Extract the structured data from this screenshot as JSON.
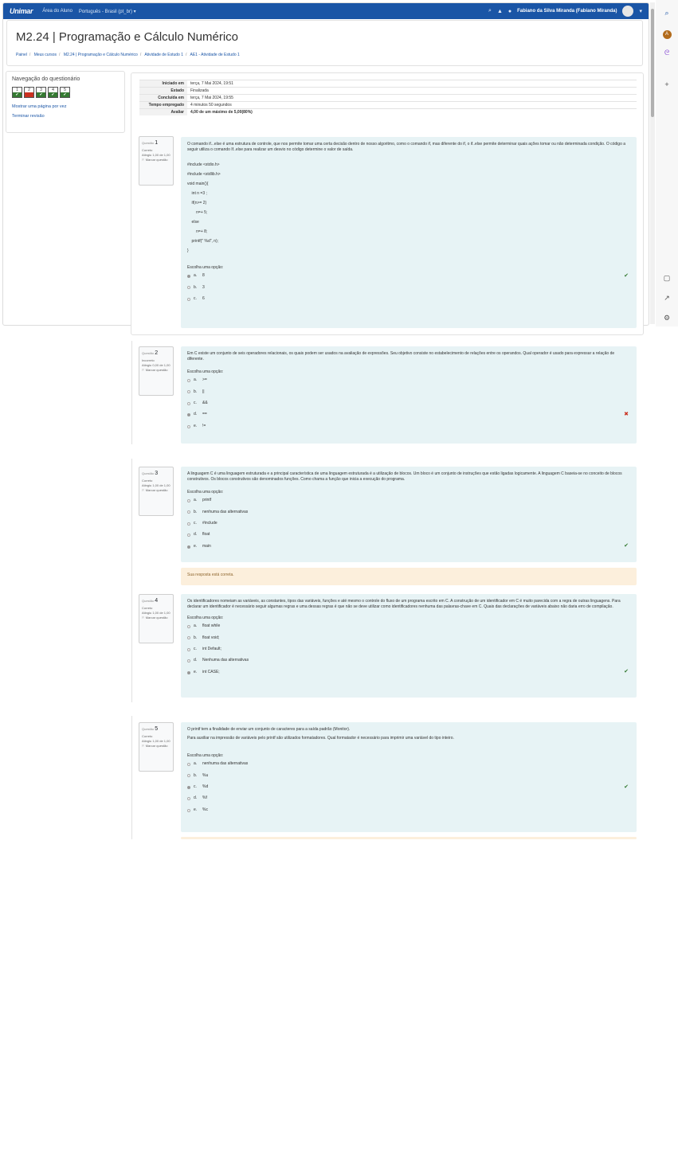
{
  "navbar": {
    "logo": "Unimar",
    "links": [
      "Área do Aluno",
      "Português - Brasil (pt_br) ▾"
    ],
    "user": "Fabiano da Silva Miranda (Fabiano Miranda)"
  },
  "header": {
    "title": "M2.24 | Programação e Cálculo Numérico",
    "breadcrumb": [
      "Painel",
      "Meus cursos",
      "M2.24 | Programação e Cálculo Numérico",
      "Atividade de Estudo 1",
      "AE1 - Atividade de Estudo 1"
    ]
  },
  "quiz_nav": {
    "title": "Navegação do questionário",
    "buttons": [
      {
        "num": "1",
        "state": "ok"
      },
      {
        "num": "2",
        "state": "bad"
      },
      {
        "num": "3",
        "state": "ok"
      },
      {
        "num": "4",
        "state": "ok"
      },
      {
        "num": "5",
        "state": "ok"
      }
    ],
    "show_one_page": "Mostrar uma página por vez",
    "end_review": "Terminar revisão"
  },
  "summary": [
    {
      "label": "Iniciado em",
      "value": "terça, 7 Mai 2024, 19:51"
    },
    {
      "label": "Estado",
      "value": "Finalizada"
    },
    {
      "label": "Concluída em",
      "value": "terça, 7 Mai 2024, 19:55"
    },
    {
      "label": "Tempo empregado",
      "value": "4 minutos 50 segundos"
    },
    {
      "label": "Avaliar",
      "value": "4,00 de um máximo de 5,00(80%)"
    }
  ],
  "questions": [
    {
      "label": "Questão",
      "number": "1",
      "status": "Correto",
      "grade": "Atingiu 1,00 de 1,00",
      "flag": "Marcar questão",
      "text": "O comando if...else é uma estrutura de controle, que nos permite tomar uma certa decisão dentro de nosso algoritmo, como o comando if, mas diferente do if, o if..else  permite determinar quais ações tomar ou não determinada condição.  O código a seguir utiliza o comando If..else para realizar um desvio no código determine o valor de saída.",
      "code": "#include <stdio.h>\n#include <stdlib.h>\nvoid main(){\n    int n =3 ;\n    if(n>= 2)\n        n=+ 5;\n    else\n        n=+ 8;\n    printf(\" %d\", n);\n}",
      "prompt": "Escolha uma opção:",
      "options": [
        {
          "letter": "a.",
          "text": "8",
          "selected": true,
          "mark": "correct"
        },
        {
          "letter": "b.",
          "text": "3",
          "selected": false,
          "mark": ""
        },
        {
          "letter": "c.",
          "text": "6",
          "selected": false,
          "mark": ""
        }
      ]
    },
    {
      "label": "Questão",
      "number": "2",
      "status": "Incorreto",
      "grade": "Atingiu 0,00 de 1,00",
      "flag": "Marcar questão",
      "text": "Em C existe um conjunto de seis operadores relacionais, os quais podem ser usados na avaliação de expressões. Seu objetivo consiste no estabelecimento de relações entre os operandos. Qual operador é usado para expressar a relação de diferente.",
      "prompt": "Escolha uma opção:",
      "options": [
        {
          "letter": "a.",
          "text": ">=",
          "selected": false,
          "mark": ""
        },
        {
          "letter": "b.",
          "text": "||",
          "selected": false,
          "mark": ""
        },
        {
          "letter": "c.",
          "text": "&&",
          "selected": false,
          "mark": ""
        },
        {
          "letter": "d.",
          "text": "==",
          "selected": true,
          "mark": "incorrect"
        },
        {
          "letter": "e.",
          "text": "!=",
          "selected": false,
          "mark": ""
        }
      ]
    },
    {
      "label": "Questão",
      "number": "3",
      "status": "Correto",
      "grade": "Atingiu 1,00 de 1,00",
      "flag": "Marcar questão",
      "text": "A linguagem C é uma linguagem estruturada e a principal característica de uma linguagem estruturada é a utilização de blocos. Um bloco é um conjunto de instruções que estão ligadas logicamente. A linguagem C baseia-se no conceito de blocos construtivos. Os blocos construtivos são denominados funções. Como chama a função que inicia a  execução do programa.",
      "prompt": "Escolha uma opção:",
      "options": [
        {
          "letter": "a.",
          "text": "printf",
          "selected": false,
          "mark": ""
        },
        {
          "letter": "b.",
          "text": "nenhuma das alternativas",
          "selected": false,
          "mark": ""
        },
        {
          "letter": "c.",
          "text": "#include",
          "selected": false,
          "mark": ""
        },
        {
          "letter": "d.",
          "text": "float",
          "selected": false,
          "mark": ""
        },
        {
          "letter": "e.",
          "text": "main",
          "selected": true,
          "mark": "correct"
        }
      ],
      "feedback": "Sua resposta está correta."
    },
    {
      "label": "Questão",
      "number": "4",
      "status": "Correto",
      "grade": "Atingiu 1,00 de 1,00",
      "flag": "Marcar questão",
      "text": "Os identificadores nomeiam as variáveis, as constantes, tipos das variáveis, funções e até mesmo o controle do fluxo de um programa escrito em C. A construção de um identificador em C é muito parecida com a regra de outras linguagens. Para declarar um identificador é necessário seguir algumas regras e uma dessas regras é que não se deve utilizar como identificadores nenhuma das palavras-chave em C. Quais das declarações de variáveis abaixo não daria erro de compilação.",
      "prompt": "Escolha uma opção:",
      "options": [
        {
          "letter": "a.",
          "text": "float while",
          "selected": false,
          "mark": ""
        },
        {
          "letter": "b.",
          "text": "float void;",
          "selected": false,
          "mark": ""
        },
        {
          "letter": "c.",
          "text": "int Default;",
          "selected": false,
          "mark": ""
        },
        {
          "letter": "d.",
          "text": "Nenhuma das alternativas",
          "selected": false,
          "mark": ""
        },
        {
          "letter": "e.",
          "text": "int CASE;",
          "selected": true,
          "mark": "correct"
        }
      ]
    },
    {
      "label": "Questão",
      "number": "5",
      "status": "Correto",
      "grade": "Atingiu 1,00 de 1,00",
      "flag": "Marcar questão",
      "text": "O printf tem a finalidade de enviar um conjunto de caracteres para a saída padrão (Monitor).",
      "text2": "Para auxiliar na impressão de variáveis pelo printf são utilizados formatadores. Qual formatador é necessário para imprimir uma variável do tipo inteiro.",
      "prompt": "Escolha uma opção:",
      "options": [
        {
          "letter": "a.",
          "text": "nenhuma das alternativas",
          "selected": false,
          "mark": ""
        },
        {
          "letter": "b.",
          "text": "%u",
          "selected": false,
          "mark": ""
        },
        {
          "letter": "c.",
          "text": "%d",
          "selected": true,
          "mark": "correct"
        },
        {
          "letter": "d.",
          "text": "%f",
          "selected": false,
          "mark": ""
        },
        {
          "letter": "e.",
          "text": "%c",
          "selected": false,
          "mark": ""
        }
      ]
    }
  ]
}
